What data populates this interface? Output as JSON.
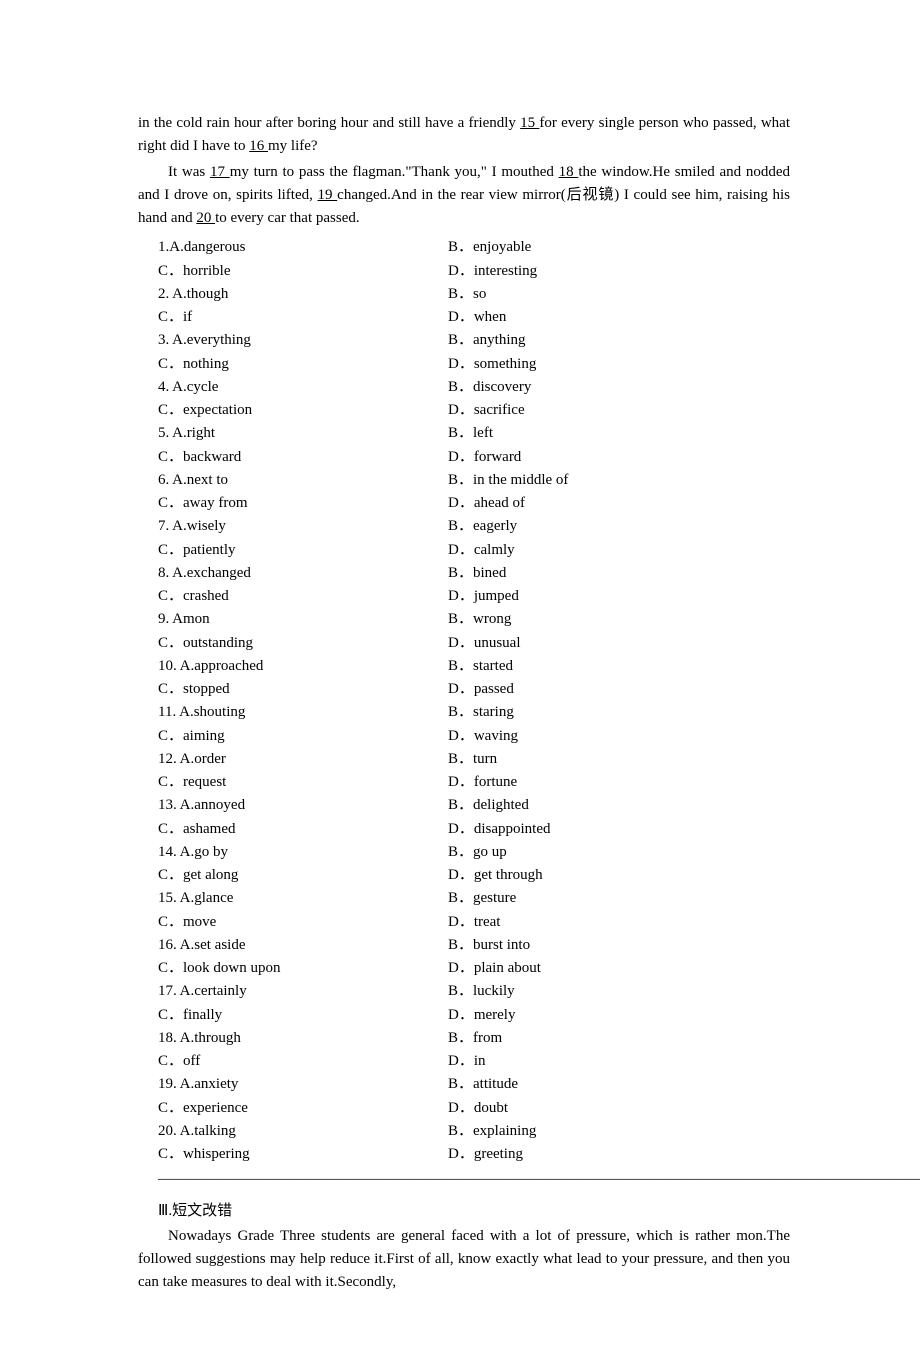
{
  "passage": {
    "line1a": "in the cold rain hour after boring hour and still have a friendly ",
    "blank15": "  15  ",
    "line1b": " for every single person who passed, what right did I have to ",
    "blank16": "  16  ",
    "line1c": " my life?",
    "line2a": "It was ",
    "blank17": "  17  ",
    "line2b": " my turn to pass the flagman.\"Thank you,\" I mouthed ",
    "blank18": "  18  ",
    "line2c": " the window.He smiled and nodded and I drove on, spirits lifted, ",
    "blank19": "  19  ",
    "line2d": " changed.And in the rear view mirror(后视镜) I could see him, raising his hand and ",
    "blank20": "  20  ",
    "line2e": " to every car that passed."
  },
  "options": [
    {
      "l": "1.A.dangerous",
      "r": "B．enjoyable"
    },
    {
      "l": "C．horrible",
      "r": "D．interesting"
    },
    {
      "l": "2. A.though",
      "r": "B．so"
    },
    {
      "l": "C．if",
      "r": "D．when"
    },
    {
      "l": "3. A.everything",
      "r": "B．anything"
    },
    {
      "l": "C．nothing",
      "r": "D．something"
    },
    {
      "l": "4. A.cycle",
      "r": "B．discovery"
    },
    {
      "l": "C．expectation",
      "r": "D．sacrifice"
    },
    {
      "l": "5. A.right",
      "r": "B．left"
    },
    {
      "l": "C．backward",
      "r": "D．forward"
    },
    {
      "l": "6. A.next to",
      "r": "B．in the middle of"
    },
    {
      "l": "C．away from",
      "r": "D．ahead of"
    },
    {
      "l": "7. A.wisely",
      "r": "B．eagerly"
    },
    {
      "l": "C．patiently",
      "r": "D．calmly"
    },
    {
      "l": "8. A.exchanged",
      "r": "B．bined"
    },
    {
      "l": "C．crashed",
      "r": "D．jumped"
    },
    {
      "l": "9. Amon",
      "r": "B．wrong"
    },
    {
      "l": "C．outstanding",
      "r": "D．unusual"
    },
    {
      "l": "10. A.approached",
      "r": "B．started"
    },
    {
      "l": "C．stopped",
      "r": "D．passed"
    },
    {
      "l": "11. A.shouting",
      "r": "B．staring"
    },
    {
      "l": "C．aiming",
      "r": "D．waving"
    },
    {
      "l": "12. A.order",
      "r": "B．turn"
    },
    {
      "l": "C．request",
      "r": "D．fortune"
    },
    {
      "l": "13. A.annoyed",
      "r": "B．delighted"
    },
    {
      "l": "C．ashamed",
      "r": "D．disappointed"
    },
    {
      "l": "14. A.go by",
      "r": "B．go up"
    },
    {
      "l": "C．get along",
      "r": "D．get through"
    },
    {
      "l": "15. A.glance",
      "r": "B．gesture"
    },
    {
      "l": "C．move",
      "r": "D．treat"
    },
    {
      "l": "16. A.set aside",
      "r": "B．burst into"
    },
    {
      "l": "C．look down upon",
      "r": "D．plain about"
    },
    {
      "l": "17. A.certainly",
      "r": "B．luckily"
    },
    {
      "l": "C．finally",
      "r": "D．merely"
    },
    {
      "l": "18. A.through",
      "r": "B．from"
    },
    {
      "l": "C．off",
      "r": "D．in"
    },
    {
      "l": "19. A.anxiety",
      "r": "B．attitude"
    },
    {
      "l": "C．experience",
      "r": "D．doubt"
    },
    {
      "l": "20. A.talking",
      "r": "B．explaining"
    },
    {
      "l": "C．whispering",
      "r": "D．greeting"
    }
  ],
  "hr": "—————————————————————————————————————————————————————————————",
  "section3": {
    "head": "Ⅲ.短文改错",
    "body": "Nowadays Grade Three students are general faced with a lot of pressure, which is rather mon.The followed suggestions may help reduce it.First of all, know exactly what lead to your pressure, and then you can take measures to deal with it.Secondly,"
  }
}
